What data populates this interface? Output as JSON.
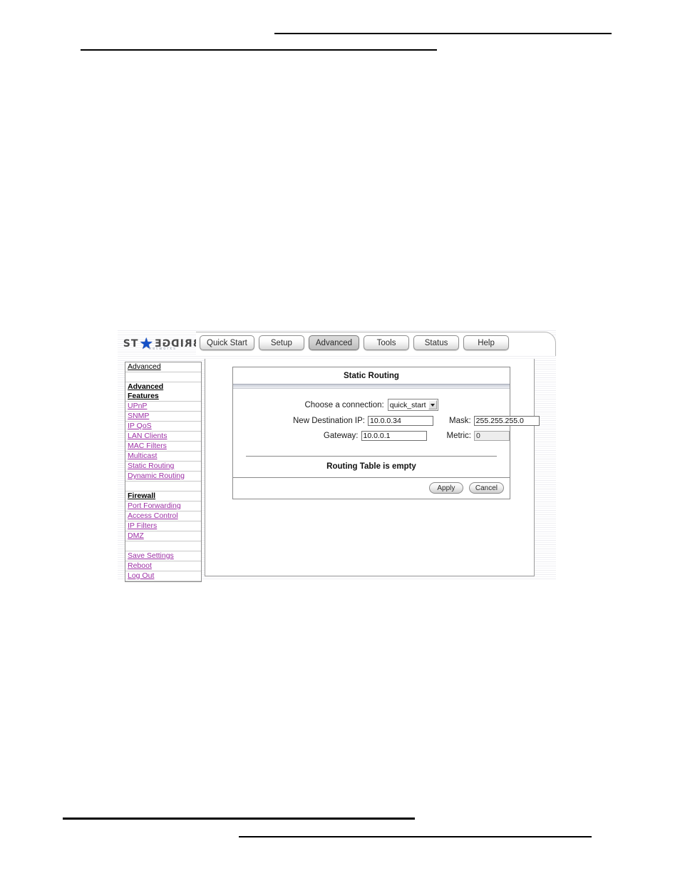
{
  "document": {
    "header_rules": 2,
    "footer_rules": 2
  },
  "app": {
    "brand": {
      "name": "ST★RBRIDGE",
      "left_text": "ST",
      "star": "★",
      "right_text": "RBRIDGE",
      "tagline": "networks"
    },
    "tabs": [
      {
        "label": "Quick Start",
        "selected": false
      },
      {
        "label": "Setup",
        "selected": false
      },
      {
        "label": "Advanced",
        "selected": true
      },
      {
        "label": "Tools",
        "selected": false
      },
      {
        "label": "Status",
        "selected": false
      },
      {
        "label": "Help",
        "selected": false
      }
    ],
    "sidebar": {
      "header": "Advanced",
      "groups": [
        {
          "title_line1": "Advanced",
          "title_line2": "Features",
          "items": [
            "UPnP",
            "SNMP",
            "IP QoS",
            "LAN Clients",
            "MAC Filters",
            "Multicast",
            "Static Routing",
            "Dynamic Routing"
          ]
        },
        {
          "title_line1": "Firewall",
          "title_line2": "",
          "items": [
            "Port Forwarding",
            "Access Control",
            "IP Filters",
            "DMZ"
          ]
        }
      ],
      "footer_items": [
        "Save Settings",
        "Reboot",
        "Log Out"
      ],
      "link_color": "#9c2fa4"
    },
    "panel": {
      "title": "Static Routing",
      "connection": {
        "label": "Choose a connection:",
        "selected": "quick_start",
        "options": [
          "quick_start"
        ]
      },
      "fields": [
        {
          "label": "New Destination IP:",
          "value": "10.0.0.34",
          "name": "new-destination-ip",
          "disabled": false
        },
        {
          "label": "Mask:",
          "value": "255.255.255.0",
          "name": "mask",
          "disabled": false
        },
        {
          "label": "Gateway:",
          "value": "10.0.0.1",
          "name": "gateway",
          "disabled": false
        },
        {
          "label": "Metric:",
          "value": "0",
          "name": "metric",
          "disabled": true
        }
      ],
      "routing_table_status": "Routing Table is empty",
      "buttons": {
        "apply": "Apply",
        "cancel": "Cancel"
      }
    }
  }
}
